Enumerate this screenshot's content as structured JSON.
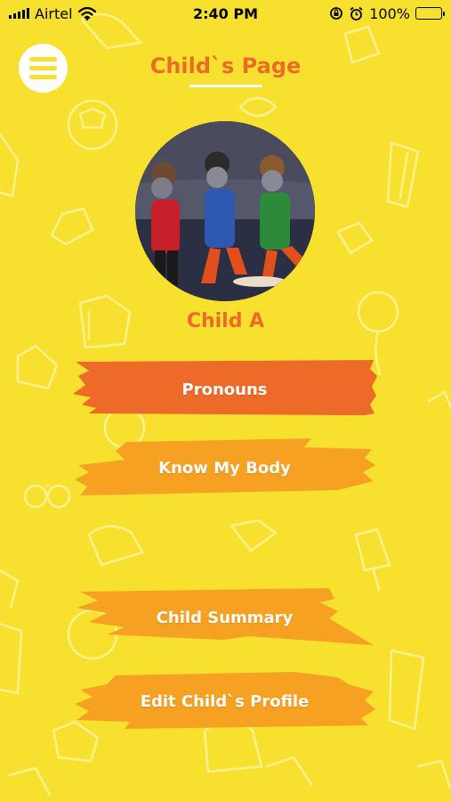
{
  "status_bar": {
    "carrier": "Airtel",
    "time": "2:40 PM",
    "battery": "100%"
  },
  "header": {
    "title": "Child`s Page"
  },
  "child": {
    "name": "Child A"
  },
  "actions": [
    {
      "label": "Pronouns",
      "color": "#EE6A28"
    },
    {
      "label": "Know My Body",
      "color": "#F7A123"
    },
    {
      "label": "Child Summary",
      "color": "#F7A123"
    },
    {
      "label": "Edit Child`s Profile",
      "color": "#F7A123"
    }
  ],
  "colors": {
    "background": "#F8E12E",
    "accent": "#EE6A28",
    "button_secondary": "#F7A123"
  }
}
